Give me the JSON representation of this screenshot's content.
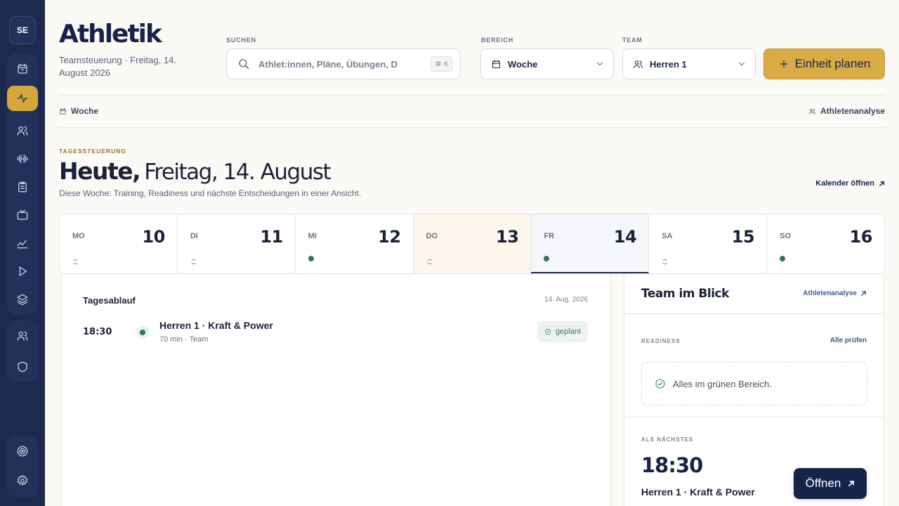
{
  "sidebar": {
    "avatar_initials": "SE",
    "items": [
      {
        "icon": "calendar-icon"
      },
      {
        "icon": "activity-icon",
        "active": true
      },
      {
        "icon": "users-icon"
      },
      {
        "icon": "dumbbell-icon"
      },
      {
        "icon": "clipboard-icon"
      },
      {
        "icon": "tv-icon"
      },
      {
        "icon": "chart-line-icon"
      },
      {
        "icon": "play-icon"
      },
      {
        "icon": "layers-icon"
      },
      {
        "icon": "team-icon"
      },
      {
        "icon": "shield-icon"
      },
      {
        "icon": "target-icon"
      },
      {
        "icon": "gear-icon"
      }
    ]
  },
  "header": {
    "title": "Athletik",
    "subtitle": "Teamsteuerung · Freitag, 14. August 2026",
    "search": {
      "label": "SUCHEN",
      "placeholder": "Athlet:innen, Pläne, Übungen, D",
      "shortcut": "K",
      "shortcut_mod": "⌘"
    },
    "range": {
      "label": "BEREICH",
      "value": "Woche"
    },
    "team": {
      "label": "TEAM",
      "value": "Herren 1"
    },
    "primary_button": "Einheit planen"
  },
  "crumbs": {
    "left": "Woche",
    "right": "Athletenanalyse"
  },
  "day_section": {
    "kicker": "TAGESSTEUERUNG",
    "headline_strong": "Heute,",
    "headline_light": "Freitag, 14. August",
    "description": "Diese Woche: Training, Readiness und nächste Entscheidungen in einer Ansicht.",
    "calendar_link": "Kalender öffnen"
  },
  "week": [
    {
      "abbr": "MO",
      "num": "10",
      "marker": "pending"
    },
    {
      "abbr": "DI",
      "num": "11",
      "marker": "pending"
    },
    {
      "abbr": "MI",
      "num": "12",
      "marker": "dot"
    },
    {
      "abbr": "DO",
      "num": "13",
      "marker": "pending",
      "state": "highlight"
    },
    {
      "abbr": "FR",
      "num": "14",
      "marker": "dot",
      "state": "selected"
    },
    {
      "abbr": "SA",
      "num": "15",
      "marker": "pending"
    },
    {
      "abbr": "SO",
      "num": "16",
      "marker": "dot"
    }
  ],
  "agenda": {
    "title": "Tagesablauf",
    "date": "14. Aug. 2026",
    "event": {
      "time": "18:30",
      "title": "Herren 1 · Kraft & Power",
      "meta": "70 min · Team",
      "status": "geplant"
    }
  },
  "team_panel": {
    "title": "Team im Blick",
    "link": "Athletenanalyse",
    "readiness_label": "READINESS",
    "readiness_link": "Alle prüfen",
    "readiness_message": "Alles im grünen Bereich.",
    "next_label": "ALS NÄCHSTES",
    "next_time": "18:30",
    "next_title": "Herren 1 · Kraft & Power",
    "open_button": "Öffnen"
  },
  "colors": {
    "sidebar": "#1c2a4e",
    "accent": "#d8ab46",
    "success": "#2c7a52",
    "navy": "#16244a"
  }
}
